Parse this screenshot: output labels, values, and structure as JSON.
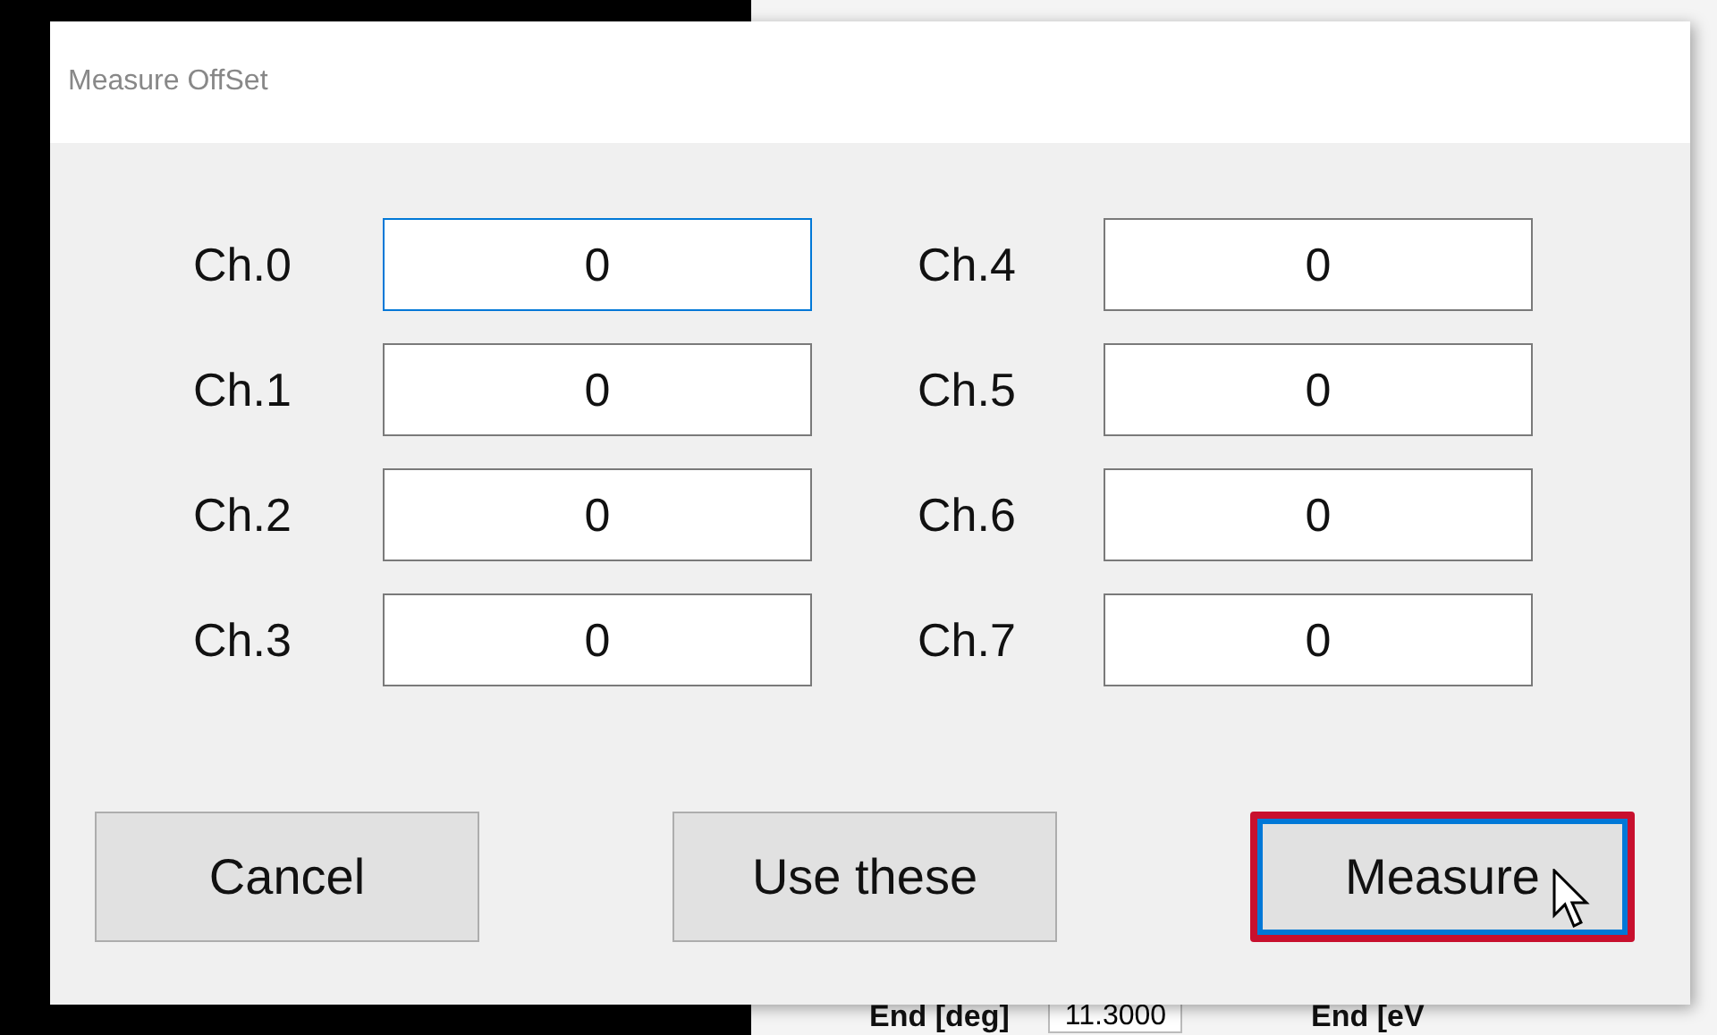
{
  "background": {
    "labels": [
      {
        "text": "End [deg]",
        "kind": "label"
      },
      {
        "text": "11.3000",
        "kind": "value"
      },
      {
        "text": "End [eV",
        "kind": "label"
      }
    ]
  },
  "dialog": {
    "title": "Measure OffSet",
    "channels": [
      {
        "label": "Ch.0",
        "value": "0",
        "focused": true
      },
      {
        "label": "Ch.1",
        "value": "0",
        "focused": false
      },
      {
        "label": "Ch.2",
        "value": "0",
        "focused": false
      },
      {
        "label": "Ch.3",
        "value": "0",
        "focused": false
      },
      {
        "label": "Ch.4",
        "value": "0",
        "focused": false
      },
      {
        "label": "Ch.5",
        "value": "0",
        "focused": false
      },
      {
        "label": "Ch.6",
        "value": "0",
        "focused": false
      },
      {
        "label": "Ch.7",
        "value": "0",
        "focused": false
      }
    ],
    "buttons": [
      {
        "label": "Cancel",
        "default": false,
        "highlighted": false
      },
      {
        "label": "Use these",
        "default": false,
        "highlighted": false
      },
      {
        "label": "Measure",
        "default": true,
        "highlighted": true
      }
    ]
  }
}
